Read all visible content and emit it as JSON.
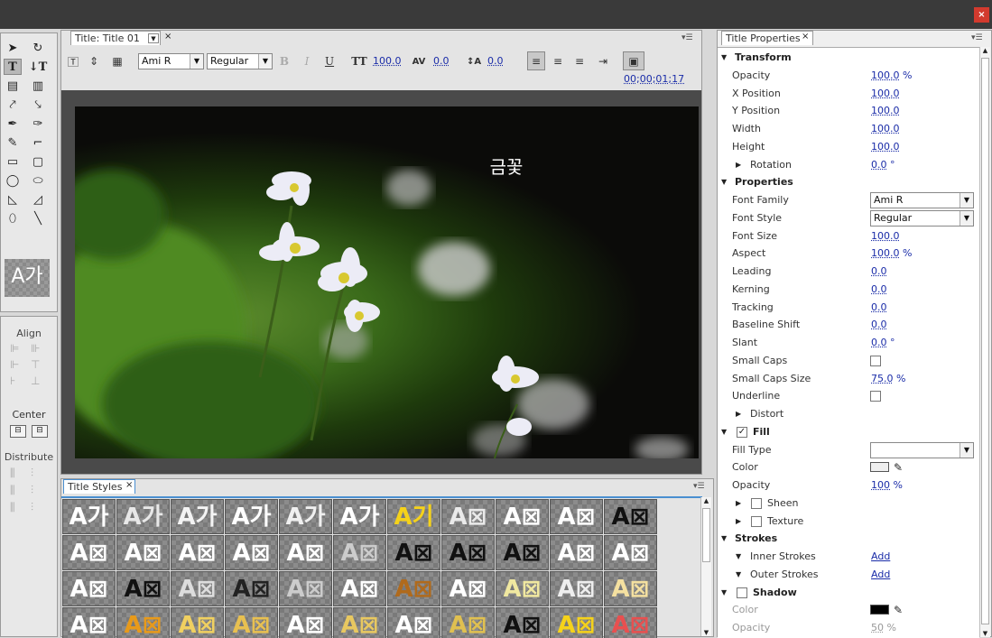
{
  "window": {
    "close_label": "×"
  },
  "title_panel": {
    "tab_label": "Title: Title 01",
    "font_family": "Ami R",
    "font_style": "Regular",
    "font_size": "100.0",
    "kerning": "0.0",
    "leading": "0.0",
    "timecode": "00;00;01;17",
    "bold_label": "B",
    "italic_label": "I",
    "underline_label": "U",
    "canvas_text": "금꽃"
  },
  "tools": {
    "style_preview": "A가"
  },
  "align_panel": {
    "align_label": "Align",
    "center_label": "Center",
    "distribute_label": "Distribute"
  },
  "styles_panel": {
    "tab_label": "Title Styles",
    "rows": [
      [
        {
          "t": "A가",
          "c": "#ffffff"
        },
        {
          "t": "A가",
          "c": "#e8e8e8"
        },
        {
          "t": "A가",
          "c": "#f4f4f4"
        },
        {
          "t": "A가",
          "c": "#ffffff"
        },
        {
          "t": "A가",
          "c": "#f0f0f0"
        },
        {
          "t": "A가",
          "c": "#ffffff"
        },
        {
          "t": "A기",
          "c": "#f5d21a"
        },
        {
          "t": "A⊠",
          "c": "#eaeaea"
        },
        {
          "t": "A⊠",
          "c": "#ffffff"
        },
        {
          "t": "A⊠",
          "c": "#ffffff"
        },
        {
          "t": "A⊠",
          "c": "#111111"
        }
      ],
      [
        {
          "t": "A⊠",
          "c": "#ffffff"
        },
        {
          "t": "A⊠",
          "c": "#ffffff"
        },
        {
          "t": "A⊠",
          "c": "#ffffff"
        },
        {
          "t": "A⊠",
          "c": "#ffffff"
        },
        {
          "t": "A⊠",
          "c": "#ffffff"
        },
        {
          "t": "A⊠",
          "c": "#cccccc"
        },
        {
          "t": "A⊠",
          "c": "#111111"
        },
        {
          "t": "A⊠",
          "c": "#111111"
        },
        {
          "t": "A⊠",
          "c": "#111111"
        },
        {
          "t": "A⊠",
          "c": "#ffffff"
        },
        {
          "t": "A⊠",
          "c": "#ffffff"
        }
      ],
      [
        {
          "t": "A⊠",
          "c": "#ffffff"
        },
        {
          "t": "A⊠",
          "c": "#111111"
        },
        {
          "t": "A⊠",
          "c": "#dddddd"
        },
        {
          "t": "A⊠",
          "c": "#222222"
        },
        {
          "t": "A⊠",
          "c": "#cccccc"
        },
        {
          "t": "A⊠",
          "c": "#ffffff"
        },
        {
          "t": "A⊠",
          "c": "#b06a1c"
        },
        {
          "t": "A⊠",
          "c": "#ffffff"
        },
        {
          "t": "A⊠",
          "c": "#f0e8a0"
        },
        {
          "t": "A⊠",
          "c": "#eeeeee"
        },
        {
          "t": "A⊠",
          "c": "#f4e0a0"
        }
      ],
      [
        {
          "t": "A⊠",
          "c": "#ffffff"
        },
        {
          "t": "A⊠",
          "c": "#e89a1a"
        },
        {
          "t": "A⊠",
          "c": "#f0d060"
        },
        {
          "t": "A⊠",
          "c": "#e8c050"
        },
        {
          "t": "A⊠",
          "c": "#ffffff"
        },
        {
          "t": "A⊠",
          "c": "#e8c860"
        },
        {
          "t": "A⊠",
          "c": "#ffffff"
        },
        {
          "t": "A⊠",
          "c": "#e0c050"
        },
        {
          "t": "A⊠",
          "c": "#111111"
        },
        {
          "t": "A⊠",
          "c": "#f5d21a"
        },
        {
          "t": "A⊠",
          "c": "#e85050"
        }
      ]
    ]
  },
  "properties": {
    "tab_label": "Title Properties",
    "rows": [
      {
        "type": "section",
        "label": "Transform",
        "arrow": "open"
      },
      {
        "type": "value",
        "label": "Opacity",
        "value": "100.0",
        "unit": "%"
      },
      {
        "type": "value",
        "label": "X Position",
        "value": "100.0",
        "unit": ""
      },
      {
        "type": "value",
        "label": "Y Position",
        "value": "100.0",
        "unit": ""
      },
      {
        "type": "value",
        "label": "Width",
        "value": "100.0",
        "unit": ""
      },
      {
        "type": "value",
        "label": "Height",
        "value": "100.0",
        "unit": ""
      },
      {
        "type": "sub",
        "label": "Rotation",
        "value": "0.0",
        "unit": "°"
      },
      {
        "type": "section",
        "label": "Properties",
        "arrow": "open"
      },
      {
        "type": "select",
        "label": "Font Family",
        "value": "Ami R"
      },
      {
        "type": "select",
        "label": "Font Style",
        "value": "Regular"
      },
      {
        "type": "value",
        "label": "Font Size",
        "value": "100.0",
        "unit": ""
      },
      {
        "type": "value",
        "label": "Aspect",
        "value": "100.0",
        "unit": "%"
      },
      {
        "type": "value",
        "label": "Leading",
        "value": "0.0",
        "unit": ""
      },
      {
        "type": "value",
        "label": "Kerning",
        "value": "0.0",
        "unit": ""
      },
      {
        "type": "value",
        "label": "Tracking",
        "value": "0.0",
        "unit": ""
      },
      {
        "type": "value",
        "label": "Baseline Shift",
        "value": "0.0",
        "unit": ""
      },
      {
        "type": "value",
        "label": "Slant",
        "value": "0.0",
        "unit": "°"
      },
      {
        "type": "check",
        "label": "Small Caps",
        "checked": false
      },
      {
        "type": "value",
        "label": "Small Caps Size",
        "value": "75.0",
        "unit": "%"
      },
      {
        "type": "check",
        "label": "Underline",
        "checked": false
      },
      {
        "type": "sub",
        "label": "Distort",
        "value": "",
        "unit": ""
      },
      {
        "type": "checksection",
        "label": "Fill",
        "checked": true
      },
      {
        "type": "select",
        "label": "Fill Type",
        "value": ""
      },
      {
        "type": "color",
        "label": "Color",
        "swatch": "#eeeeee"
      },
      {
        "type": "value",
        "label": "Opacity",
        "value": "100",
        "unit": "%"
      },
      {
        "type": "subcheck",
        "label": "Sheen",
        "checked": false
      },
      {
        "type": "subcheck",
        "label": "Texture",
        "checked": false
      },
      {
        "type": "section",
        "label": "Strokes",
        "arrow": "open"
      },
      {
        "type": "add",
        "label": "Inner Strokes",
        "value": "Add"
      },
      {
        "type": "add",
        "label": "Outer Strokes",
        "value": "Add"
      },
      {
        "type": "checksection",
        "label": "Shadow",
        "checked": false
      },
      {
        "type": "color",
        "label": "Color",
        "swatch": "#000000",
        "dim": true
      },
      {
        "type": "value",
        "label": "Opacity",
        "value": "50",
        "unit": "%",
        "dim": true
      }
    ]
  }
}
